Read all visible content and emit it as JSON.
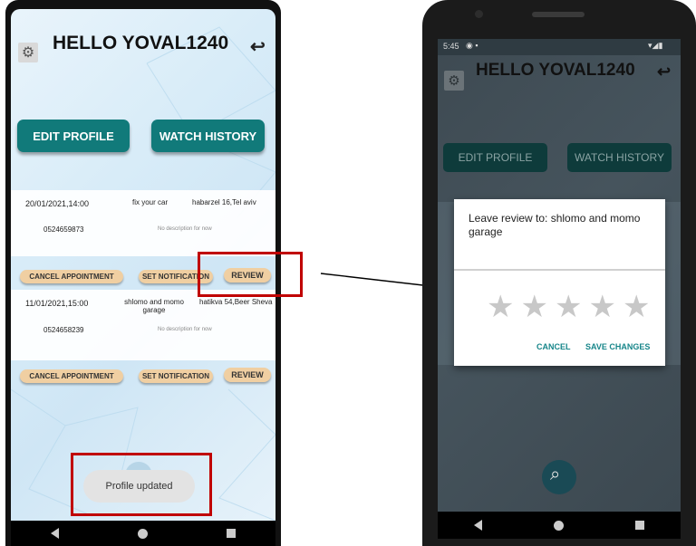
{
  "left": {
    "greeting": "HELLO YOVAL1240",
    "edit_profile_label": "EDIT PROFILE",
    "watch_history_label": "WATCH HISTORY",
    "appointments": [
      {
        "datetime": "20/01/2021,14:00",
        "service": "fix your car",
        "address": "habarzel 16,Tel aviv",
        "phone": "0524659873",
        "description": "No description for now",
        "cancel_label": "CANCEL APPOINTMENT",
        "notify_label": "SET NOTIFICATION",
        "review_label": "REVIEW"
      },
      {
        "datetime": "11/01/2021,15:00",
        "service": "shlomo and momo garage",
        "address": "hatikva 54,Beer Sheva",
        "phone": "0524658239",
        "description": "No description for now",
        "cancel_label": "CANCEL APPOINTMENT",
        "notify_label": "SET NOTIFICATION",
        "review_label": "REVIEW"
      }
    ],
    "toast": "Profile updated"
  },
  "right": {
    "status_time": "5:45",
    "greeting": "HELLO YOVAL1240",
    "edit_profile_label": "EDIT PROFILE",
    "watch_history_label": "WATCH HISTORY",
    "dialog": {
      "title": "Leave review to: shlomo and momo garage",
      "rating": 0,
      "max_rating": 5,
      "cancel_label": "CANCEL",
      "save_label": "SAVE CHANGES"
    }
  },
  "colors": {
    "teal": "#117a7a",
    "pill": "#f0cfa2",
    "highlight": "#c00000",
    "dialog_accent": "#17868a"
  }
}
